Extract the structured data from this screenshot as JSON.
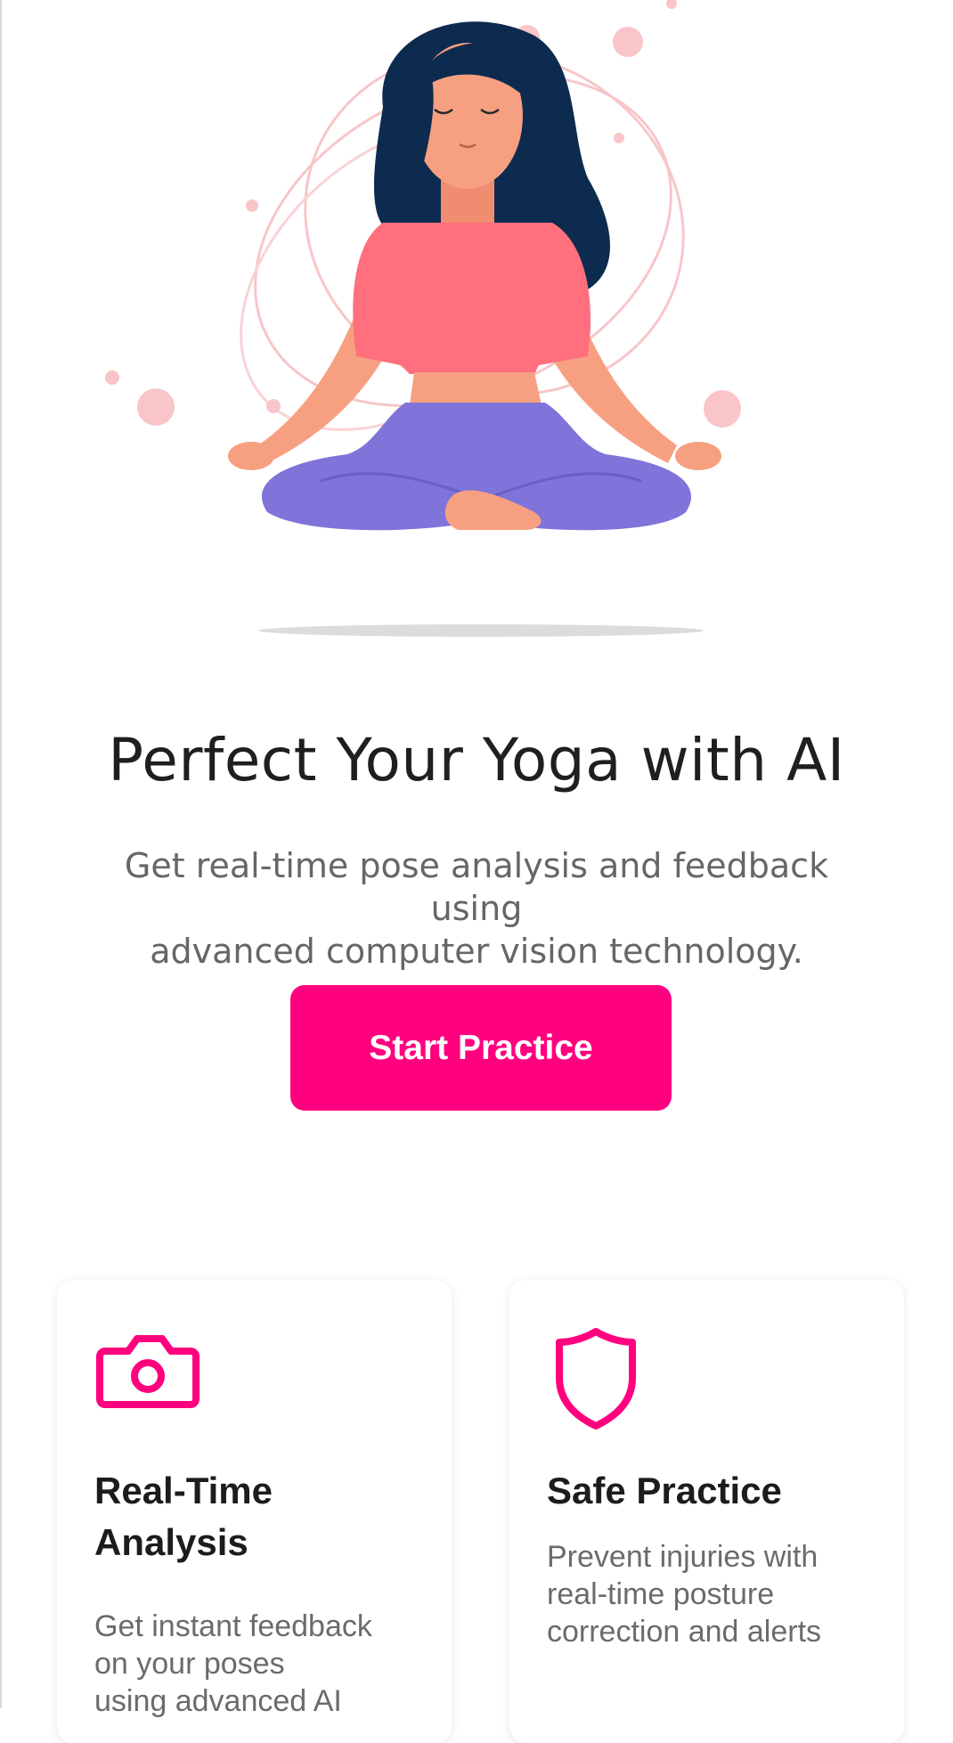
{
  "hero": {
    "illustration": "meditating-woman-illustration",
    "colors": {
      "hair": "#0d2b4f",
      "skin": "#f7a081",
      "top": "#ff6f7d",
      "pants": "#7f74d9",
      "orbit": "#f7c6c9",
      "shadow": "#dcdcdc"
    }
  },
  "headline": "Perfect Your Yoga with AI",
  "subtitle_lines": [
    "Get real-time pose analysis and feedback using",
    "advanced computer vision technology."
  ],
  "cta": {
    "label": "Start Practice",
    "color": "#ff007f"
  },
  "features": [
    {
      "icon": "camera-icon",
      "title_lines": [
        "Real-Time",
        "Analysis"
      ],
      "desc_lines": [
        "Get instant feedback",
        "on your poses",
        "using advanced AI"
      ]
    },
    {
      "icon": "shield-icon",
      "title_lines": [
        "Safe Practice"
      ],
      "desc_lines": [
        "Prevent injuries with",
        "real-time posture",
        "correction and alerts"
      ]
    }
  ],
  "accent_color": "#ff007f"
}
